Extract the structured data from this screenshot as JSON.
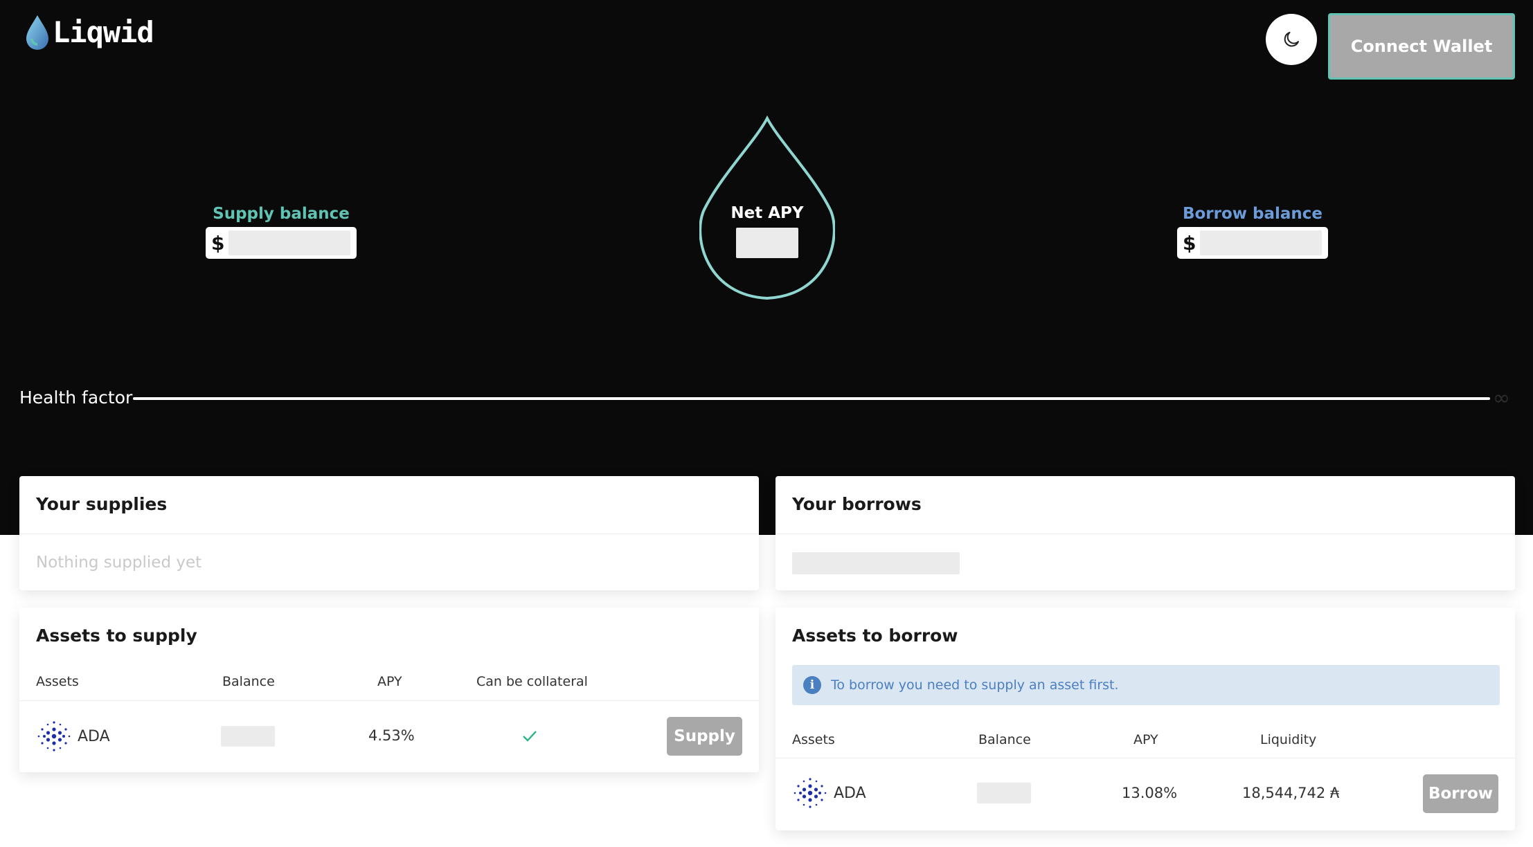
{
  "header": {
    "logo_text": "Liqwid",
    "theme_toggle_icon": "moon-icon",
    "connect_wallet_label": "Connect Wallet"
  },
  "summary": {
    "supply_label": "Supply balance",
    "supply_currency": "$",
    "net_apy_label": "Net APY",
    "borrow_label": "Borrow balance",
    "borrow_currency": "$"
  },
  "health": {
    "label": "Health factor",
    "value_symbol": "∞"
  },
  "your_supplies": {
    "title": "Your supplies",
    "empty_text": "Nothing supplied yet"
  },
  "your_borrows": {
    "title": "Your borrows"
  },
  "assets_to_supply": {
    "title": "Assets to supply",
    "columns": [
      "Assets",
      "Balance",
      "APY",
      "Can be collateral"
    ],
    "rows": [
      {
        "asset": "ADA",
        "icon": "cardano-icon",
        "apy": "4.53%",
        "collateral_icon": "check-icon",
        "action": "Supply"
      }
    ]
  },
  "assets_to_borrow": {
    "title": "Assets to borrow",
    "info_icon": "info-icon",
    "info_text": "To borrow you need to supply an asset first.",
    "columns": [
      "Assets",
      "Balance",
      "APY",
      "Liquidity"
    ],
    "rows": [
      {
        "asset": "ADA",
        "icon": "cardano-icon",
        "apy": "13.08%",
        "liquidity": "18,544,742 ₳",
        "action": "Borrow"
      }
    ]
  },
  "colors": {
    "hero_bg": "#0a0a0a",
    "accent_teal": "#5fc4b4",
    "accent_blue": "#6b9bd9",
    "button_gray": "#a8a8a8",
    "info_bg": "#dbe6f3"
  }
}
